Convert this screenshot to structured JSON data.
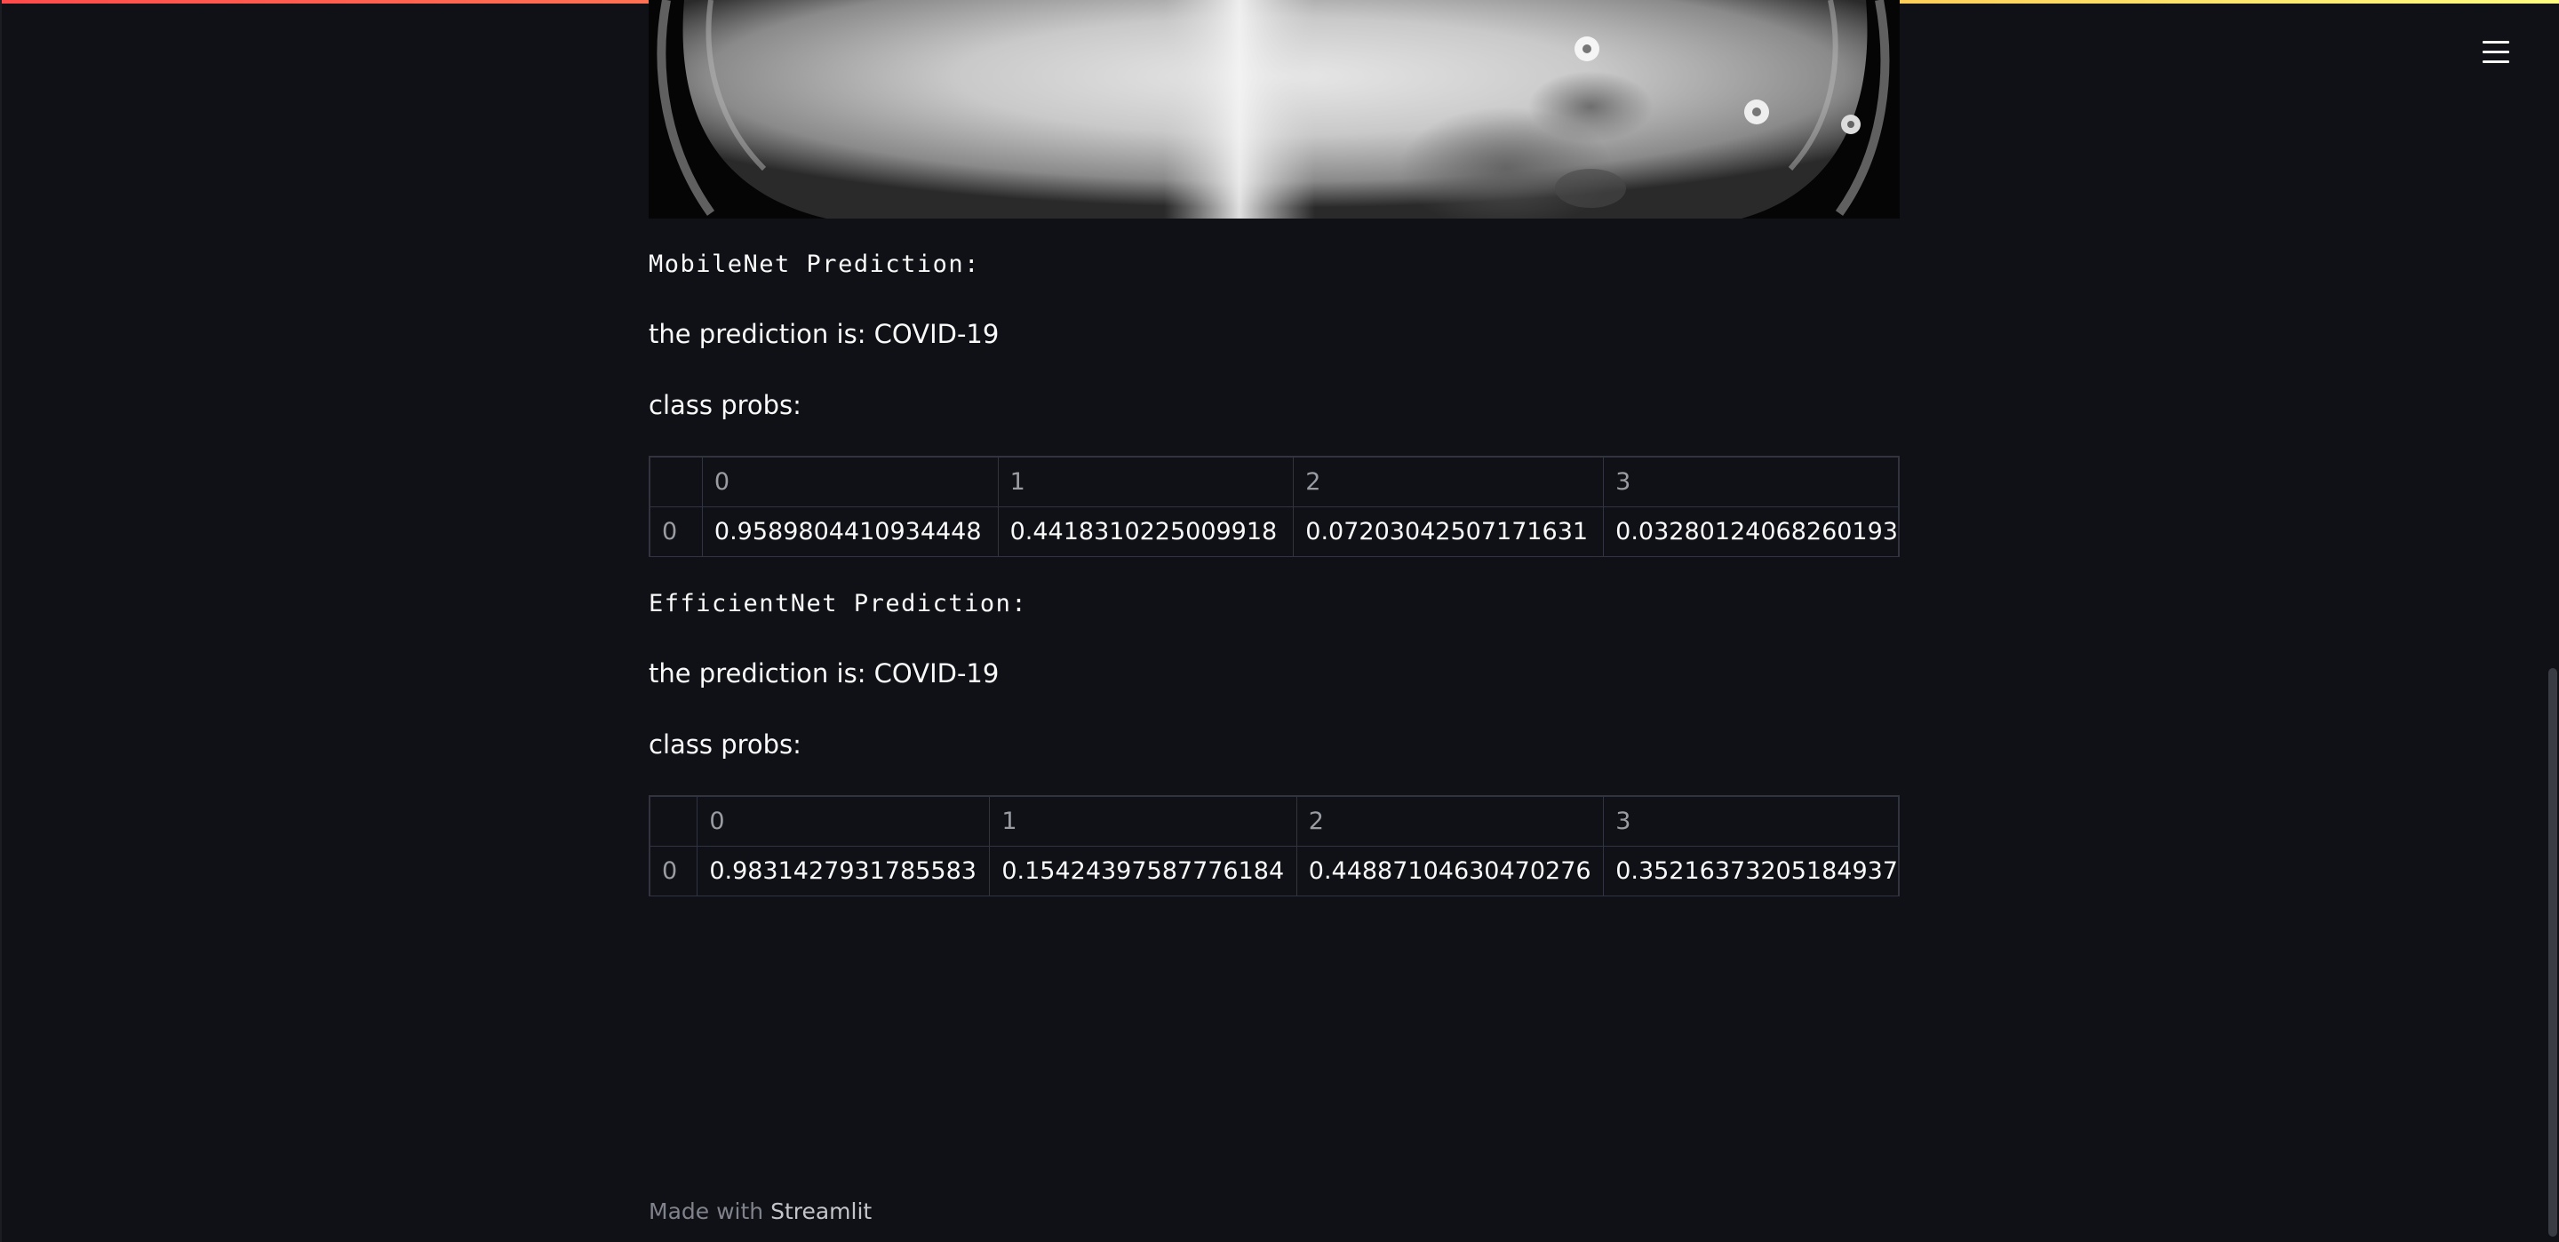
{
  "header": {
    "menu_icon": "hamburger-menu-icon",
    "decoration_colors": [
      "#ff4b4b",
      "#ffd05a",
      "#fffd80"
    ]
  },
  "image": {
    "description_icon": "chest-xray-image"
  },
  "mobilenet": {
    "heading": "MobileNet Prediction:",
    "prediction_text": "the prediction is: COVID-19",
    "probs_label": "class probs:",
    "table": {
      "columns": [
        "0",
        "1",
        "2",
        "3"
      ],
      "rows": [
        {
          "index": "0",
          "values": [
            "0.9589804410934448",
            "0.4418310225009918",
            "0.07203042507171631",
            "0.03280124068260193"
          ]
        }
      ]
    }
  },
  "efficientnet": {
    "heading": "EfficientNet Prediction:",
    "prediction_text": "the prediction is: COVID-19",
    "probs_label": "class probs:",
    "table": {
      "columns": [
        "0",
        "1",
        "2",
        "3"
      ],
      "rows": [
        {
          "index": "0",
          "values": [
            "0.9831427931785583",
            "0.15424397587776184",
            "0.44887104630470276",
            "0.35216373205184937"
          ]
        }
      ]
    }
  },
  "footer": {
    "prefix": "Made with ",
    "brand": "Streamlit"
  }
}
